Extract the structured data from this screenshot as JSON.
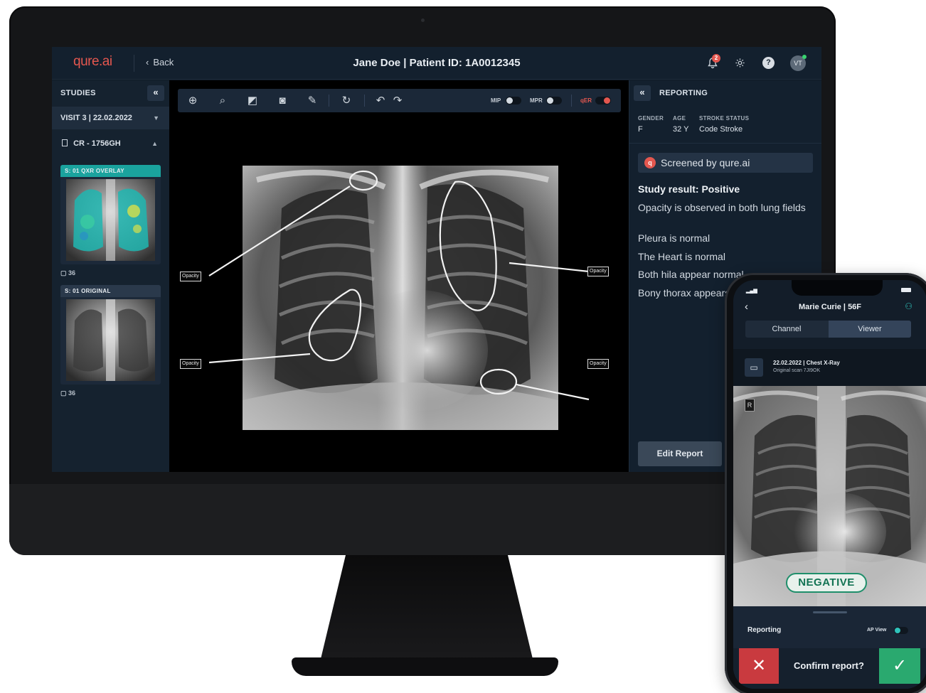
{
  "app": {
    "logo": "qure.ai",
    "back_label": "Back",
    "patient_title": "Jane Doe | Patient ID: 1A0012345",
    "notification_count": "2",
    "help_glyph": "?",
    "user_initials": "VT",
    "icons": [
      "bell-icon",
      "gear-icon",
      "help-icon",
      "avatar"
    ]
  },
  "studies": {
    "heading": "STUDIES",
    "collapse_glyph": "«",
    "visit": "VISIT 3 | 22.02.2022",
    "series": "CR - 1756GH",
    "thumbnails": [
      {
        "label": "S: 01  QXR OVERLAY",
        "count": "36",
        "header_color": "#1aa39e"
      },
      {
        "label": "S: 01  ORIGINAL",
        "count": "36",
        "header_color": "#2a394b"
      }
    ]
  },
  "viewer": {
    "toggles": [
      {
        "label": "MIP",
        "on": false
      },
      {
        "label": "MPR",
        "on": false
      },
      {
        "label": "qER",
        "on": true
      }
    ],
    "annotations": [
      "Opacity",
      "Opacity",
      "Opacity",
      "Opacity"
    ]
  },
  "reporting": {
    "heading": "REPORTING",
    "collapse_glyph": "«",
    "meta": [
      {
        "label": "GENDER",
        "value": "F"
      },
      {
        "label": "AGE",
        "value": "32 Y"
      },
      {
        "label": "STROKE STATUS",
        "value": "Code Stroke"
      }
    ],
    "screened": "Screened by qure.ai",
    "result_title": "Study result: Positive",
    "findings": [
      "Opacity is observed in both lung fields",
      "Pleura is normal",
      "The Heart is normal",
      "Both hila appear normal",
      "Bony thorax appears"
    ],
    "edit_label": "Edit Report",
    "accent": "#e4574f",
    "teal": "#1f9c98"
  },
  "phone": {
    "title": "Marie Curie | 56F",
    "tabs": [
      "Channel",
      "Viewer"
    ],
    "active_tab": "Viewer",
    "scan_title": "22.02.2022 | Chest X-Ray",
    "scan_sub": "Original scan 7JI9OK",
    "r_marker": "R",
    "verdict": "NEGATIVE",
    "reporting_label": "Reporting",
    "ap_view_label": "AP View",
    "confirm_label": "Confirm report?",
    "reject_glyph": "✕",
    "accept_glyph": "✓"
  }
}
